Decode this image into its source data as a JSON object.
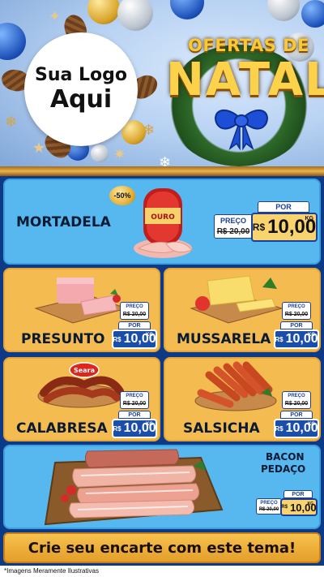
{
  "header": {
    "logo_line1": "Sua Logo",
    "logo_line2": "Aqui",
    "title_top": "OFERTAS DE",
    "title_main": "NATAL"
  },
  "products": [
    {
      "name": "MORTADELA",
      "discount": "-50%",
      "brand": "OURO",
      "preco_label": "PREÇO",
      "old_price": "R$ 20,00",
      "por_label": "POR",
      "currency": "R$",
      "new_price": "10,00",
      "unit": "KG"
    },
    {
      "name": "PRESUNTO",
      "preco_label": "PREÇO",
      "old_price": "R$ 20,00",
      "por_label": "POR",
      "currency": "R$",
      "new_price": "10,00",
      "unit": "KG"
    },
    {
      "name": "MUSSARELA",
      "preco_label": "PREÇO",
      "old_price": "R$ 20,00",
      "por_label": "POR",
      "currency": "R$",
      "new_price": "10,00",
      "unit": "KG"
    },
    {
      "name": "CALABRESA",
      "brand": "Seara",
      "preco_label": "PREÇO",
      "old_price": "R$ 20,00",
      "por_label": "POR",
      "currency": "R$",
      "new_price": "10,00",
      "unit": "KG"
    },
    {
      "name": "SALSICHA",
      "preco_label": "PREÇO",
      "old_price": "R$ 20,00",
      "por_label": "POR",
      "currency": "R$",
      "new_price": "10,00",
      "unit": "KG"
    },
    {
      "name_line1": "BACON",
      "name_line2": "PEDAÇO",
      "preco_label": "PREÇO",
      "old_price": "R$ 20,00",
      "por_label": "POR",
      "currency": "R$",
      "new_price": "10,00",
      "unit": "KG"
    }
  ],
  "banner": "Crie seu encarte com este tema!",
  "disclaimer": "*Imagens Meramente Ilustrativas",
  "colors": {
    "card_blue": "#56b8ef",
    "card_gold": "#f4bb51",
    "price_blue": "#1b4ea8",
    "background": "#0d3a86"
  }
}
